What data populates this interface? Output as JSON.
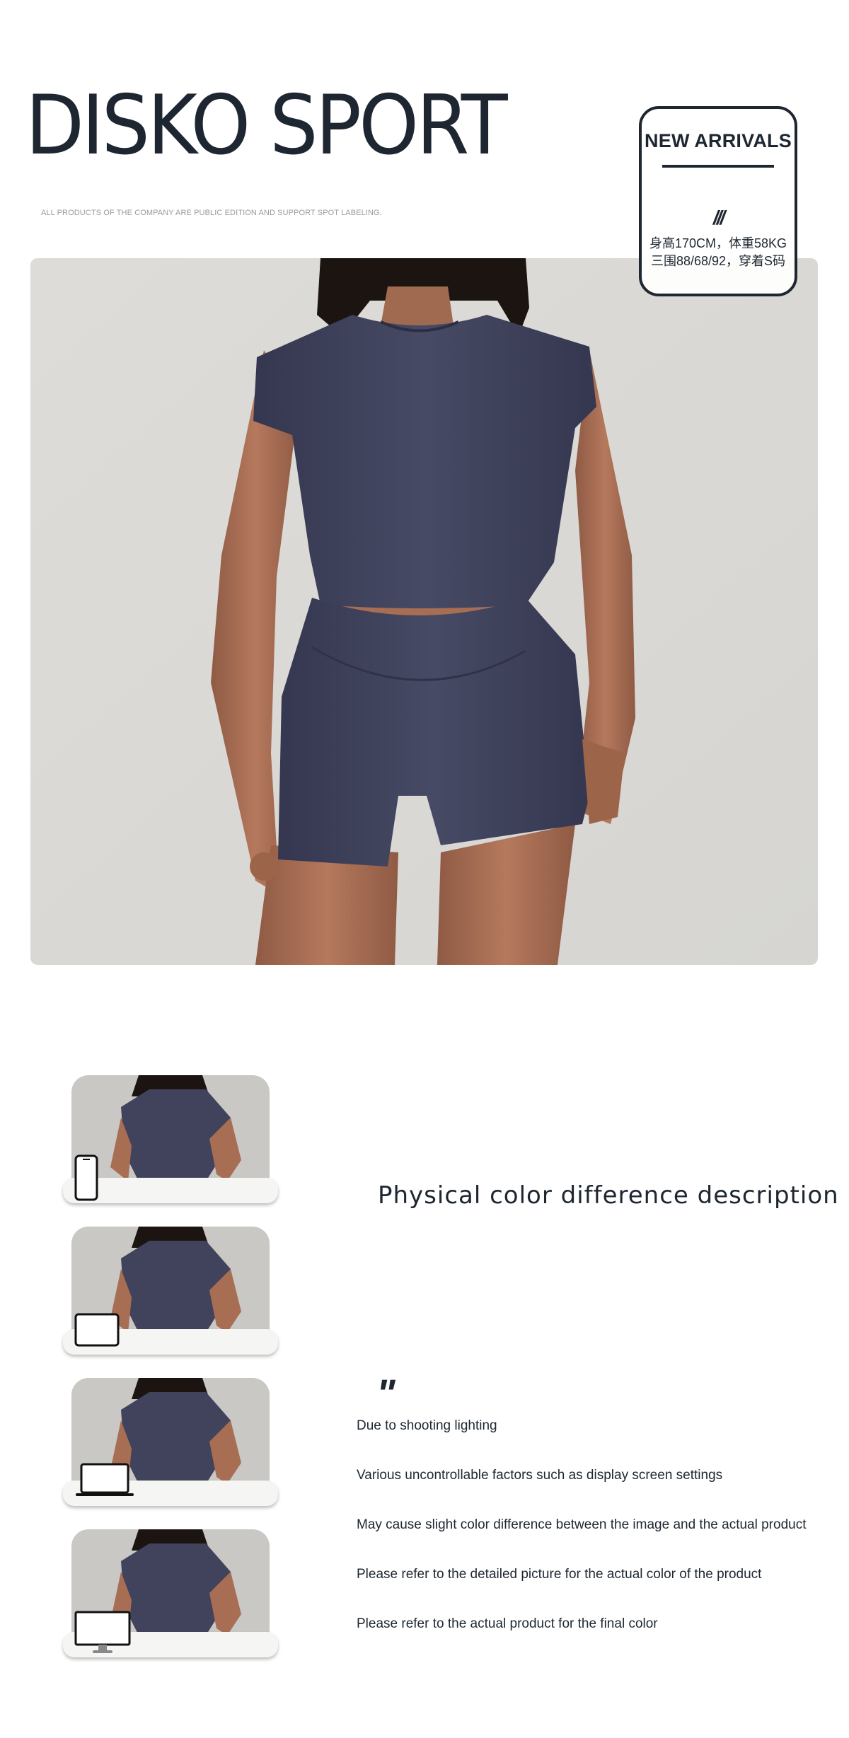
{
  "brand": {
    "name": "DISKO SPORT",
    "tagline": "ALL PRODUCTS OF THE COMPANY ARE PUBLIC EDITION AND SUPPORT SPOT LABELING."
  },
  "new_arrivals": {
    "title": "NEW ARRIVALS",
    "mark": "///",
    "model_info_line1": "身高170CM，体重58KG",
    "model_info_line2": "三围88/68/92，穿着S码"
  },
  "hero": {
    "description": "Model wearing navy short-sleeve crop top and high-waist shorts"
  },
  "color_notice": {
    "heading": "Physical color difference description",
    "quote_mark": "\"",
    "lines": [
      "Due to shooting lighting",
      "Various uncontrollable factors such as display screen settings",
      "May cause slight color difference between the image and the actual product",
      "Please refer to the detailed picture for the actual color of the product",
      "Please refer to the actual product for the final color"
    ]
  },
  "devices": [
    {
      "icon": "phone-icon"
    },
    {
      "icon": "tablet-icon"
    },
    {
      "icon": "laptop-icon"
    },
    {
      "icon": "monitor-icon"
    }
  ],
  "colors": {
    "garment": "#41435c",
    "background": "#dcdbd7",
    "skin": "#a86e54",
    "ink": "#1e2731"
  }
}
